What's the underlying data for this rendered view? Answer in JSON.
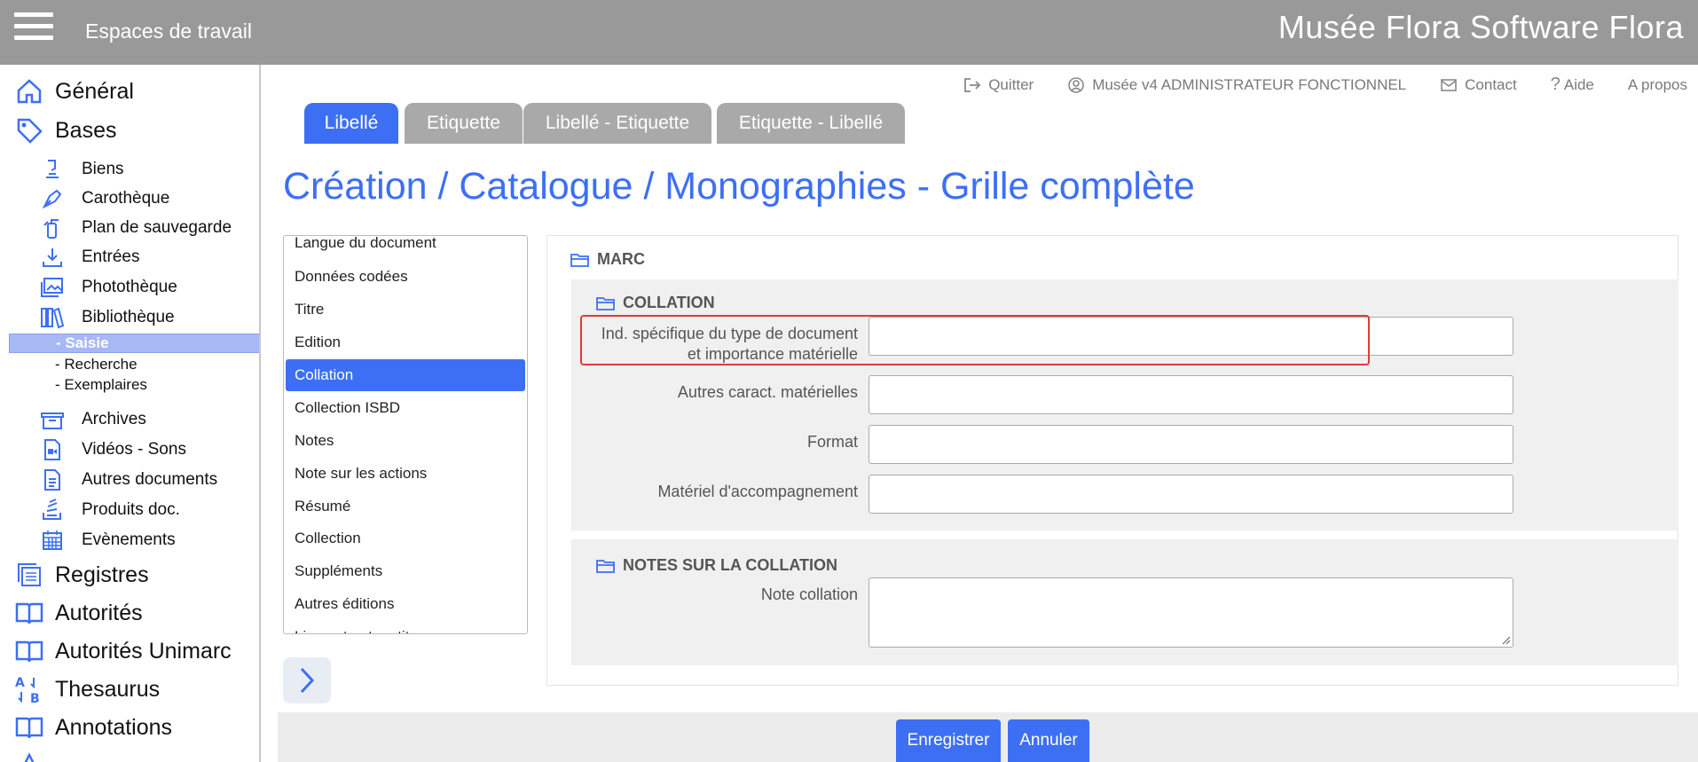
{
  "header": {
    "workspace_label": "Espaces de travail",
    "app_title": "Musée Flora Software Flora"
  },
  "sidebar": {
    "general": "Général",
    "bases": "Bases",
    "bases_items": [
      "Biens",
      "Carothèque",
      "Plan de sauvegarde",
      "Entrées",
      "Photothèque",
      "Bibliothèque"
    ],
    "bibliotheque_sub": [
      "- Saisie",
      "- Recherche",
      "- Exemplaires"
    ],
    "more_items": [
      "Archives",
      "Vidéos - Sons",
      "Autres documents",
      "Produits doc.",
      "Evènements"
    ],
    "main_items": [
      "Registres",
      "Autorités",
      "Autorités Unimarc",
      "Thesaurus",
      "Annotations"
    ]
  },
  "utils": {
    "quit": "Quitter",
    "user": "Musée v4 ADMINISTRATEUR FONCTIONNEL",
    "contact": "Contact",
    "help": "Aide",
    "about": "A propos"
  },
  "tabs": [
    "Libellé",
    "Etiquette",
    "Libellé - Etiquette",
    "Etiquette - Libellé"
  ],
  "page_title": "Création / Catalogue / Monographies - Grille complète",
  "field_list": [
    "Langue du document",
    "Données codées",
    "Titre",
    "Edition",
    "Collation",
    "Collection ISBD",
    "Notes",
    "Note sur les actions",
    "Résumé",
    "Collection",
    "Suppléments",
    "Autres éditions",
    "Liens et autres titres"
  ],
  "form": {
    "section": "MARC",
    "collation": {
      "title": "COLLATION",
      "fields": [
        {
          "label_line1": "Ind. spécifique du type de document",
          "label_line2": "et importance matérielle",
          "value": ""
        },
        {
          "label": "Autres caract. matérielles",
          "value": ""
        },
        {
          "label": "Format",
          "value": ""
        },
        {
          "label": "Matériel d'accompagnement",
          "value": ""
        }
      ]
    },
    "notes": {
      "title": "NOTES SUR LA COLLATION",
      "field_label": "Note collation",
      "value": ""
    }
  },
  "buttons": {
    "save": "Enregistrer",
    "cancel": "Annuler"
  },
  "colors": {
    "accent": "#3d6ff5",
    "topbar": "#999999",
    "highlight": "#e23a3a"
  }
}
